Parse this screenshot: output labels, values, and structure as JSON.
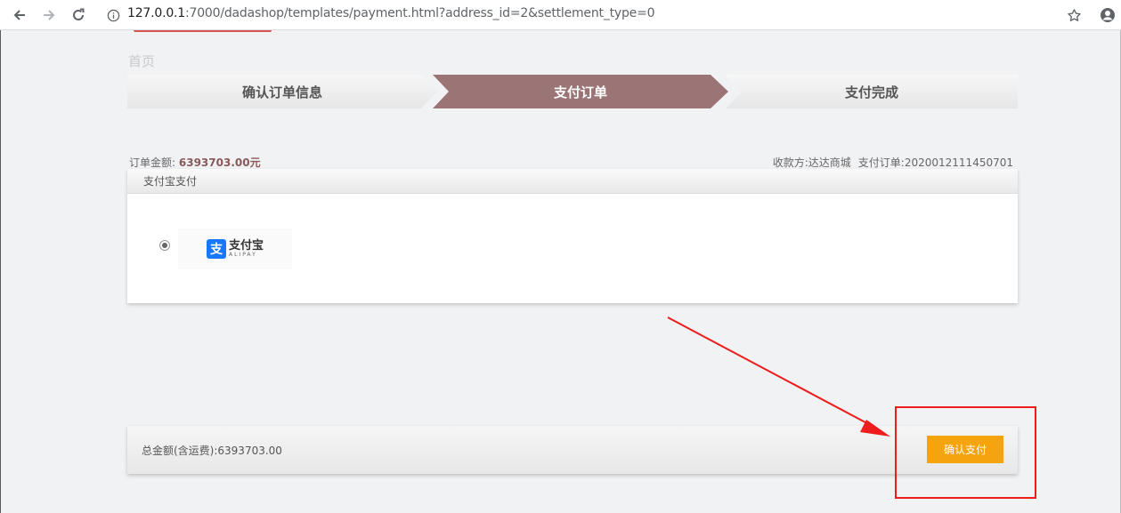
{
  "browser": {
    "url_host": "127.0.0.1",
    "url_rest": ":7000/dadashop/templates/payment.html?address_id=2&settlement_type=0",
    "icons": [
      "back-icon",
      "forward-icon",
      "reload-icon",
      "info-icon",
      "star-icon",
      "profile-icon"
    ]
  },
  "page": {
    "home_link": "首页",
    "steps": [
      {
        "label": "确认订单信息",
        "active": false
      },
      {
        "label": "支付订单",
        "active": true
      },
      {
        "label": "支付完成",
        "active": false
      }
    ],
    "order": {
      "amount_label": "订单金额:",
      "amount_value": "6393703.00元",
      "payee": "收款方:达达商城",
      "order_no": "支付订单:2020012111450701"
    },
    "payment": {
      "header": "支付宝支付",
      "method_selected": true,
      "logo_badge": "支",
      "logo_cn": "支付宝",
      "logo_en": "ALIPAY"
    },
    "footer": {
      "total_text": "总金额(含运费):6393703.00",
      "confirm_label": "确认支付"
    }
  },
  "colors": {
    "active_step": "#9b7576",
    "inactive_step": "#ededed",
    "confirm_button": "#f5a30f",
    "annotation_red": "#ee1c1c",
    "alipay_blue": "#1678ff"
  }
}
